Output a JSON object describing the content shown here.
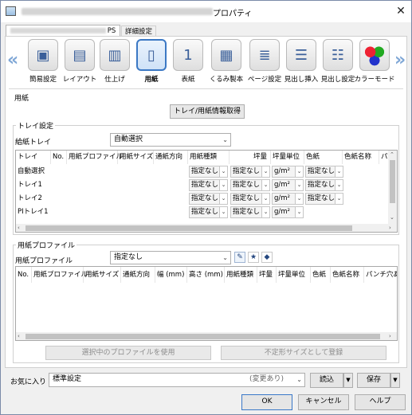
{
  "window": {
    "title": "プロパティ"
  },
  "tabs": [
    {
      "label": "PS"
    },
    {
      "label": "詳細設定"
    }
  ],
  "toolbar": {
    "items": [
      {
        "label": "簡易設定",
        "icon": "quick-setting-icon"
      },
      {
        "label": "レイアウト",
        "icon": "layout-icon"
      },
      {
        "label": "仕上げ",
        "icon": "finishing-icon"
      },
      {
        "label": "用紙",
        "icon": "paper-icon"
      },
      {
        "label": "表紙",
        "icon": "cover-icon"
      },
      {
        "label": "くるみ製本",
        "icon": "perfect-binding-icon"
      },
      {
        "label": "ページ設定",
        "icon": "page-setting-icon"
      },
      {
        "label": "見出し挿入",
        "icon": "tab-insert-icon"
      },
      {
        "label": "見出し設定",
        "icon": "tab-setting-icon"
      },
      {
        "label": "カラーモード",
        "icon": "color-mode-icon"
      }
    ],
    "selected": "用紙"
  },
  "paper_section": {
    "title": "用紙",
    "tray_info_button": "トレイ/用紙情報取得"
  },
  "tray_settings": {
    "title": "トレイ設定",
    "feed_tray_label": "給紙トレイ",
    "feed_tray_value": "自動選択",
    "columns": [
      "トレイ",
      "No.",
      "用紙プロファイル",
      "用紙サイズ",
      "通紙方向",
      "用紙種類",
      "坪量",
      "坪量単位",
      "色紙",
      "色紙名称",
      "パ"
    ],
    "rows": [
      {
        "tray": "自動選択",
        "type": "指定なし",
        "weight": "指定なし",
        "unit": "g/m²",
        "color": "指定なし"
      },
      {
        "tray": "トレイ1",
        "type": "指定なし",
        "weight": "指定なし",
        "unit": "g/m²",
        "color": "指定なし"
      },
      {
        "tray": "トレイ2",
        "type": "指定なし",
        "weight": "指定なし",
        "unit": "g/m²",
        "color": "指定なし"
      },
      {
        "tray": "PIトレイ1",
        "type": "指定なし",
        "weight": "指定なし",
        "unit": "g/m²",
        "color": ""
      }
    ]
  },
  "profile_section": {
    "title": "用紙プロファイル",
    "label": "用紙プロファイル",
    "value": "指定なし",
    "columns": [
      "No.",
      "用紙プロファイル",
      "用紙サイズ",
      "通紙方向",
      "幅 (mm)",
      "高さ (mm)",
      "用紙種類",
      "坪量",
      "坪量単位",
      "色紙",
      "色紙名称",
      "パンチ穴あ"
    ],
    "use_button": "選択中のプロファイルを使用",
    "register_button": "不定形サイズとして登録"
  },
  "favorites": {
    "label": "お気に入り",
    "value": "標準設定",
    "modified": "(変更あり)",
    "load_button": "読込",
    "save_button": "保存"
  },
  "dialog_buttons": {
    "ok": "OK",
    "cancel": "キャンセル",
    "help": "ヘルプ"
  }
}
